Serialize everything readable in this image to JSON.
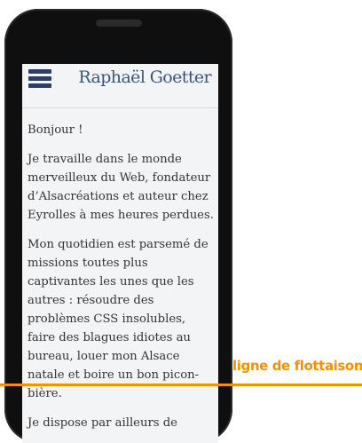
{
  "header": {
    "menu_icon": "hamburger-menu-icon",
    "site_title": "Raphaël Goetter"
  },
  "article": {
    "paragraphs": [
      "Bonjour !",
      "Je travaille dans le monde merveilleux du Web, fondateur d’Alsacréations et auteur chez Eyrolles à mes heures perdues.",
      "Mon quotidien est parsemé de missions toutes plus captivantes les unes que les autres : résoudre des problèmes CSS insolubles, faire des blagues idiotes au bureau, louer mon Alsace natale et boire un bon picon-bière.",
      "Je dispose par ailleurs de"
    ]
  },
  "annotation": {
    "fold_label": "ligne de flottaison",
    "fold_color": "#f39200"
  },
  "colors": {
    "menu_icon": "#2e3e63",
    "title": "#3d5478",
    "screen_bg": "#f3f4f6",
    "phone_body": "#0f0f0f"
  }
}
